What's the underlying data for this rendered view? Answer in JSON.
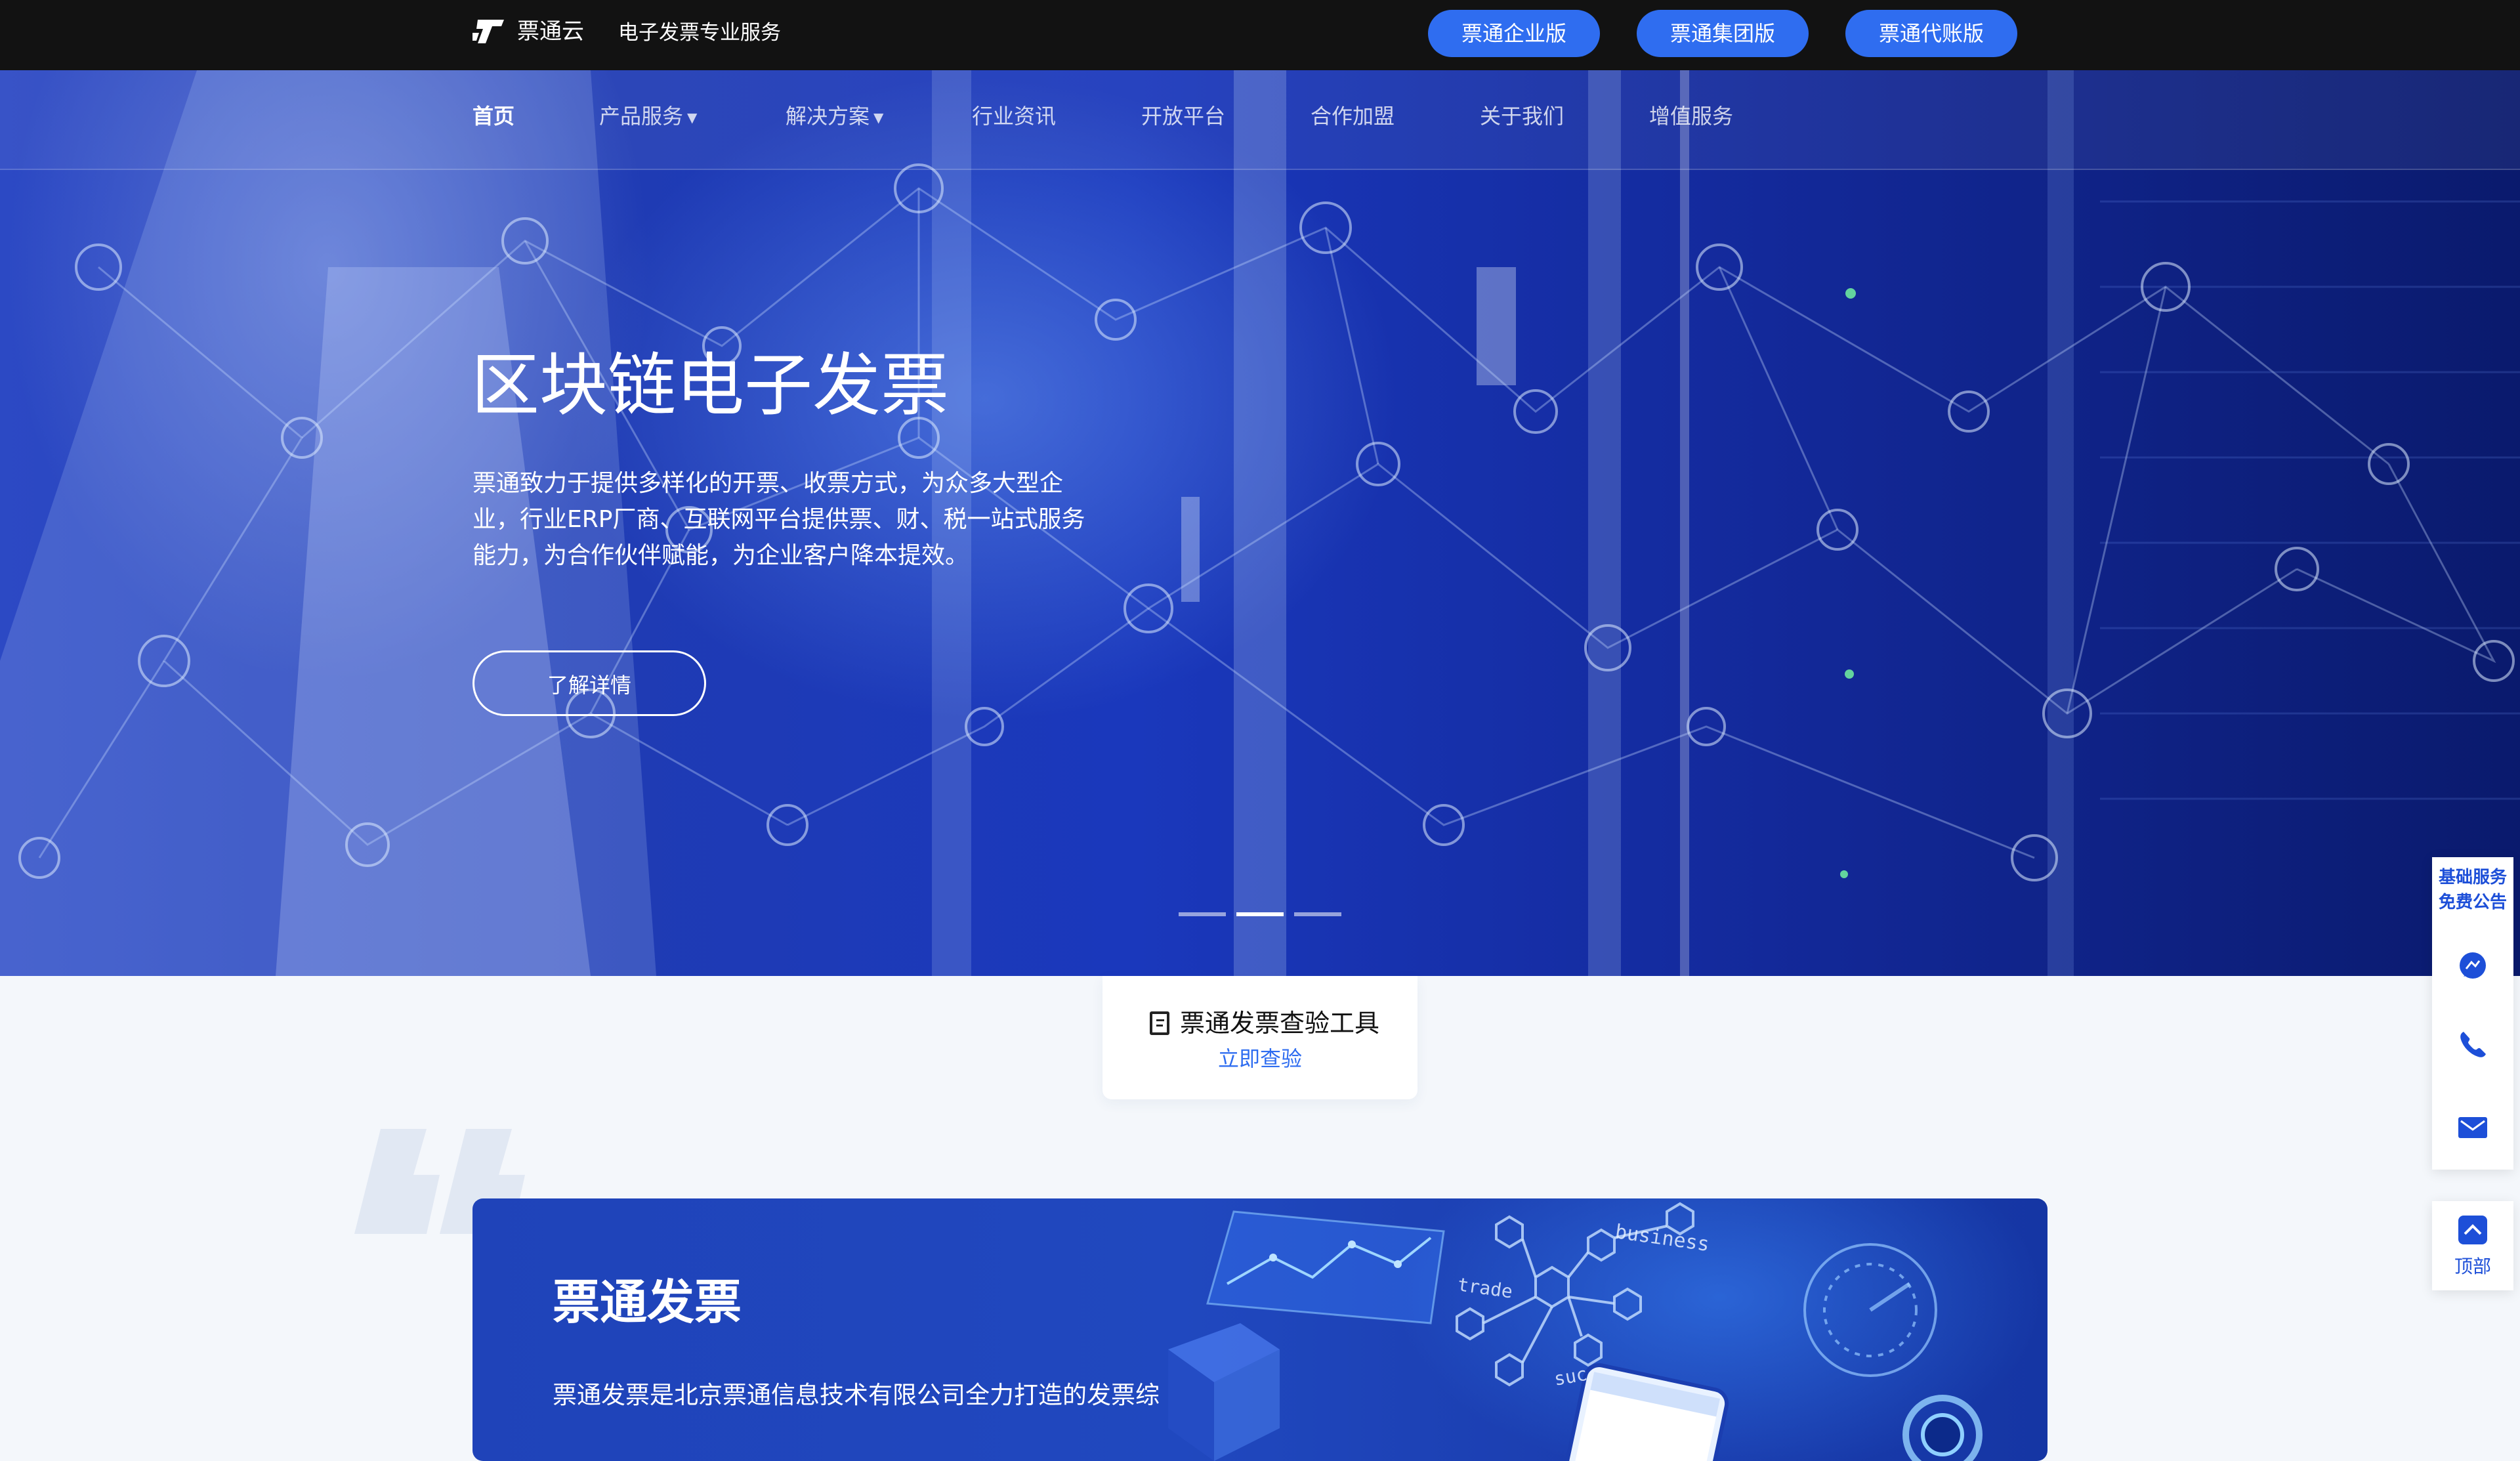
{
  "header": {
    "brand": "票通云",
    "tagline": "电子发票专业服务",
    "editions": [
      "票通企业版",
      "票通集团版",
      "票通代账版"
    ]
  },
  "nav": {
    "items": [
      {
        "label": "首页",
        "active": true,
        "dropdown": false
      },
      {
        "label": "产品服务",
        "active": false,
        "dropdown": true
      },
      {
        "label": "解决方案",
        "active": false,
        "dropdown": true
      },
      {
        "label": "行业资讯",
        "active": false,
        "dropdown": false
      },
      {
        "label": "开放平台",
        "active": false,
        "dropdown": false
      },
      {
        "label": "合作加盟",
        "active": false,
        "dropdown": false
      },
      {
        "label": "关于我们",
        "active": false,
        "dropdown": false
      },
      {
        "label": "增值服务",
        "active": false,
        "dropdown": false
      }
    ]
  },
  "hero": {
    "title": "区块链电子发票",
    "description_lines": [
      "票通致力于提供多样化的开票、收票方式，为众多大型企",
      "业，行业ERP厂商、互联网平台提供票、财、税一站式服务",
      "能力，为合作伙伴赋能，为企业客户降本提效。"
    ],
    "button": "了解详情",
    "slides": 3,
    "active_slide": 1
  },
  "verify": {
    "title": "票通发票查验工具",
    "link": "立即查验"
  },
  "feature": {
    "title": "票通发票",
    "description": "票通发票是北京票通信息技术有限公司全力打造的发票综",
    "deco_words": [
      "business",
      "trade",
      "suc"
    ]
  },
  "float_panel": {
    "badge_line1": "基础服务",
    "badge_line2": "免费公告",
    "icons": [
      "chat-icon",
      "phone-icon",
      "mail-icon"
    ],
    "top_label": "顶部"
  },
  "colors": {
    "accent": "#2f6df0",
    "topbar": "#121212",
    "hero_blue": "#1f3bb4"
  }
}
